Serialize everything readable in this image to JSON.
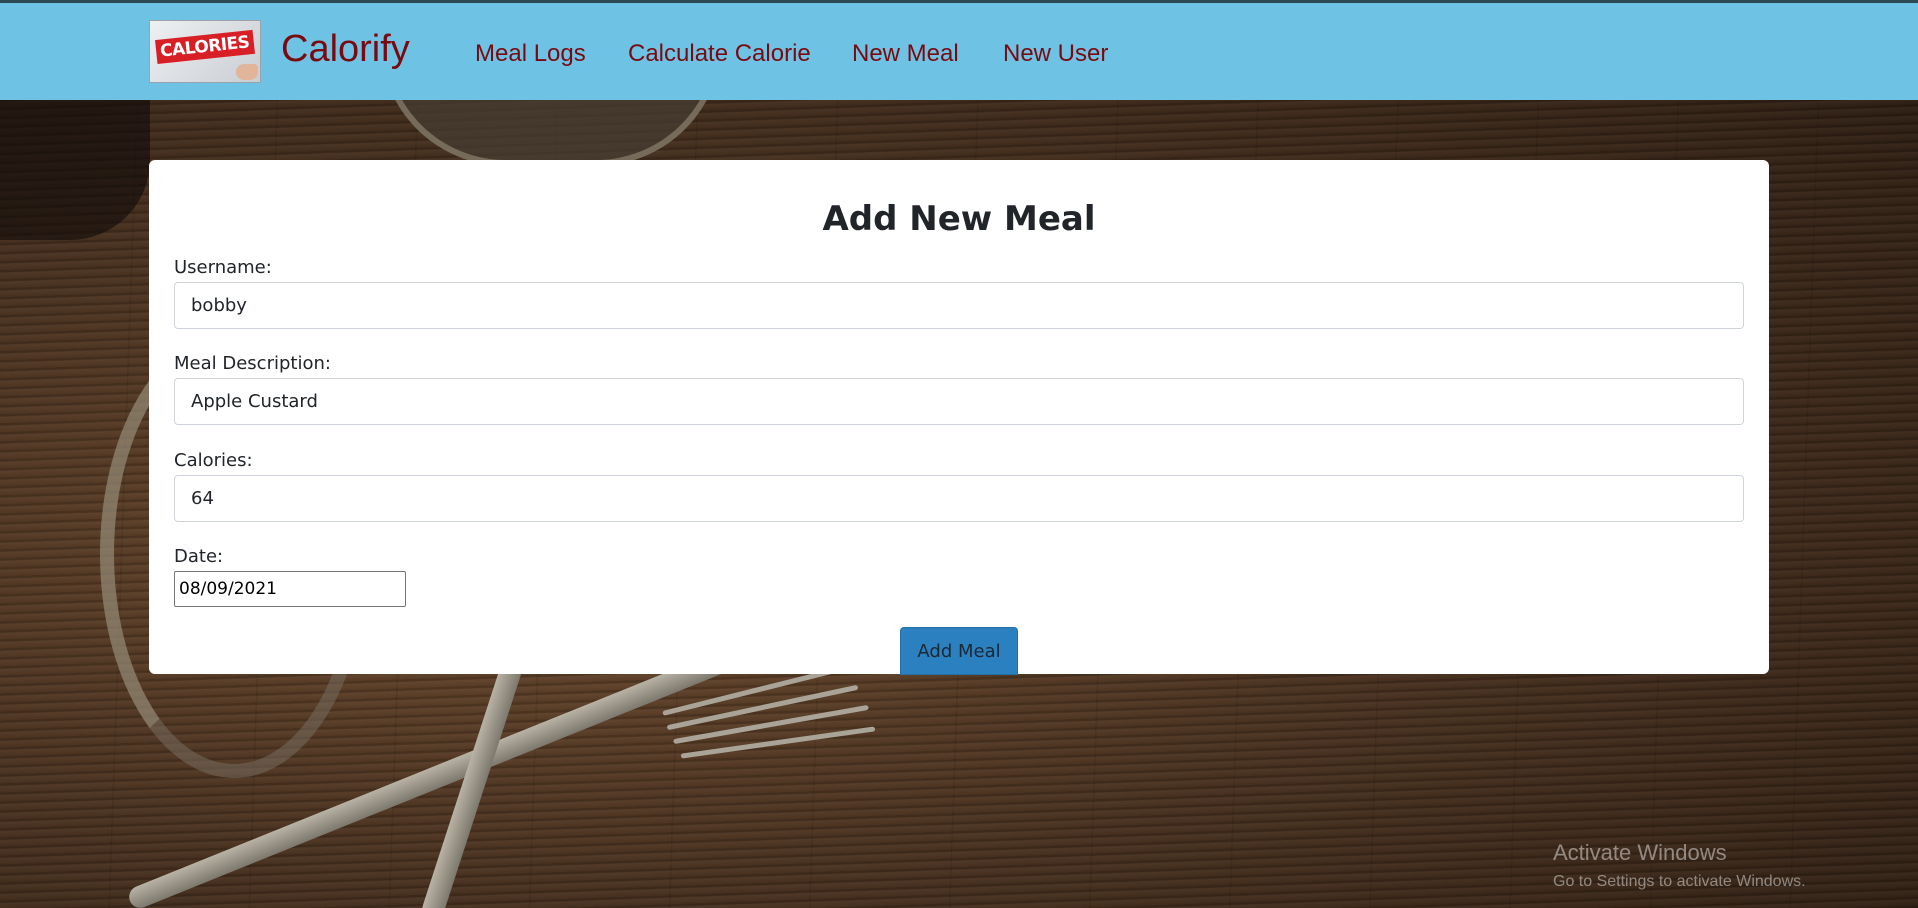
{
  "brand": {
    "name": "Calorify",
    "logo_text": "CALORIES"
  },
  "nav": {
    "items": [
      {
        "label": "Meal Logs"
      },
      {
        "label": "Calculate Calorie"
      },
      {
        "label": "New Meal"
      },
      {
        "label": "New User"
      }
    ]
  },
  "form": {
    "title": "Add New Meal",
    "username": {
      "label": "Username:",
      "value": "bobby"
    },
    "meal_description": {
      "label": "Meal Description:",
      "value": "Apple Custard"
    },
    "calories": {
      "label": "Calories:",
      "value": "64"
    },
    "date": {
      "label": "Date:",
      "value": "08/09/2021"
    },
    "submit_label": "Add Meal"
  },
  "windows_watermark": {
    "title": "Activate Windows",
    "subtitle": "Go to Settings to activate Windows."
  },
  "colors": {
    "navbar": "#6ec2e3",
    "brand_text": "#7b0a10",
    "button": "#2b80c0"
  }
}
